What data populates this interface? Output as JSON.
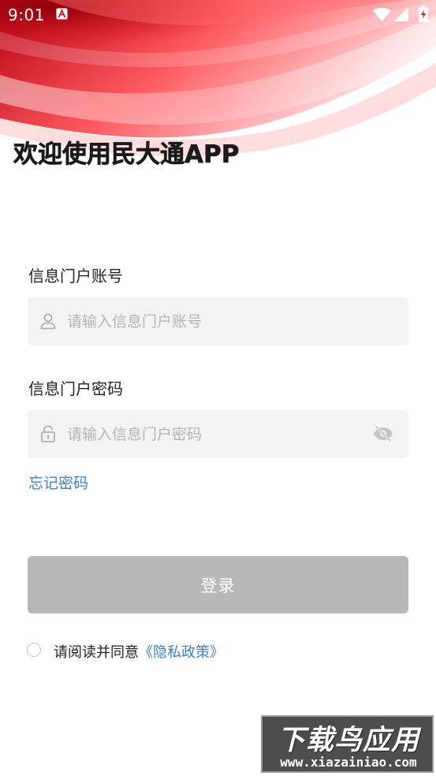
{
  "status_bar": {
    "time": "9:01"
  },
  "welcome": {
    "title": "欢迎使用民大通APP"
  },
  "account": {
    "label": "信息门户账号",
    "placeholder": "请输入信息门户账号",
    "icon": "user-icon"
  },
  "password": {
    "label": "信息门户密码",
    "placeholder": "请输入信息门户密码",
    "icon": "lock-icon",
    "toggle_icon": "eye-off-icon"
  },
  "forgot": {
    "label": "忘记密码"
  },
  "login": {
    "label": "登录"
  },
  "agreement": {
    "prefix": "请阅读并同意",
    "link": "《隐私政策》",
    "checked": false
  },
  "watermark": {
    "title": "下载鸟应用",
    "url": "www.xiazainiao.com"
  },
  "colors": {
    "accent": "#3b7fd0",
    "button_disabled": "#b8b8b8",
    "input_bg": "#f3f3f3",
    "header_red": "#e0101e"
  }
}
